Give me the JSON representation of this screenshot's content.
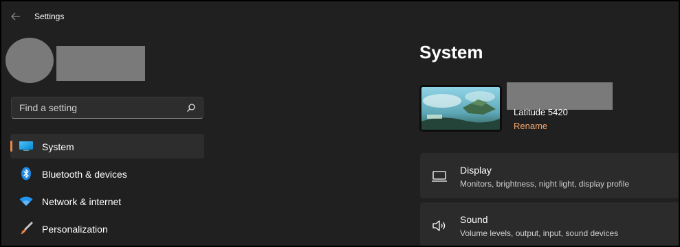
{
  "window": {
    "title": "Settings"
  },
  "search": {
    "placeholder": "Find a setting"
  },
  "sidebar": {
    "items": [
      {
        "label": "System",
        "icon": "system-display-icon",
        "active": true
      },
      {
        "label": "Bluetooth & devices",
        "icon": "bluetooth-icon",
        "active": false
      },
      {
        "label": "Network & internet",
        "icon": "wifi-icon",
        "active": false
      },
      {
        "label": "Personalization",
        "icon": "paintbrush-icon",
        "active": false
      }
    ]
  },
  "main": {
    "title": "System",
    "device": {
      "model": "Latitude 5420",
      "rename_label": "Rename"
    },
    "cards": [
      {
        "title": "Display",
        "description": "Monitors, brightness, night light, display profile",
        "icon": "monitor-icon"
      },
      {
        "title": "Sound",
        "description": "Volume levels, output, input, sound devices",
        "icon": "speaker-icon"
      }
    ]
  },
  "colors": {
    "accent": "#f08a4b",
    "window_bg": "#202020",
    "card_bg": "#2b2b2b",
    "link": "#f0a46a"
  }
}
